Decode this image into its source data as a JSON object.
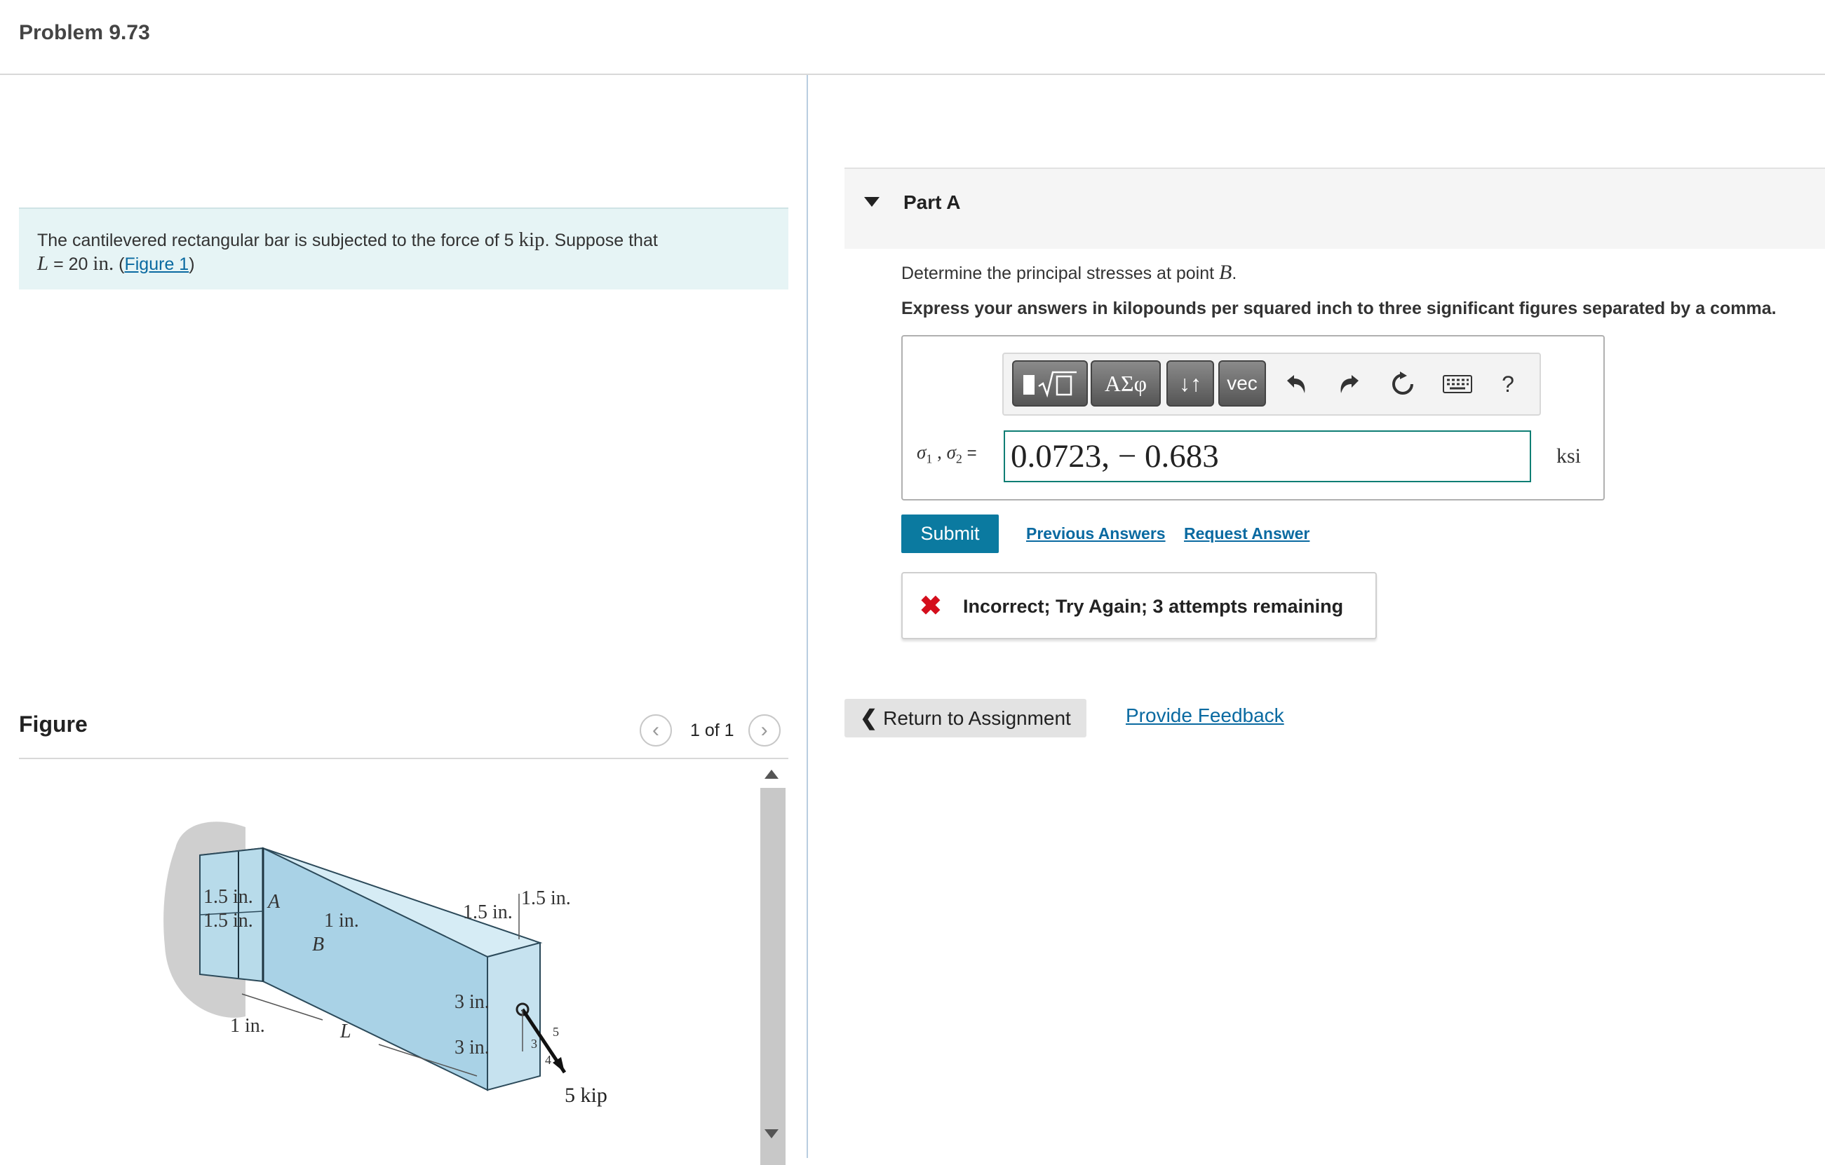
{
  "header": {
    "title": "Problem 9.73"
  },
  "intro": {
    "text_before_force": "The cantilevered rectangular bar is subjected to the force of 5 ",
    "force_unit": "kip",
    "text_after_force": ". Suppose that",
    "length_symbol": "L",
    "length_eq": " = 20 ",
    "length_unit": "in.",
    "paren_open": " (",
    "figure_link": "Figure 1",
    "paren_close": ")"
  },
  "figure_panel": {
    "label": "Figure",
    "prev_icon": "chevron-left-icon",
    "next_icon": "chevron-right-icon",
    "count": "1 of 1",
    "diagram_labels": {
      "a1": "1.5 in.",
      "a2": "1.5 in.",
      "point_a": "A",
      "one_in_top": "1 in.",
      "point_b": "B",
      "one_in_bottom": "1 in.",
      "length": "L",
      "width_mid": "1.5 in.",
      "width_end": "1.5 in.",
      "h1": "3 in.",
      "h2": "3 in.",
      "slope_3": "3",
      "slope_4": "4",
      "slope_5": "5",
      "force": "5 kip"
    }
  },
  "part_a": {
    "title": "Part A",
    "question_prefix": "Determine the principal stresses at point ",
    "question_point": "B",
    "question_suffix": ".",
    "instruction": "Express your answers in kilopounds per squared inch to three significant figures separated by a comma.",
    "toolbar": {
      "templates_icon": "templates-icon",
      "greek_label": "ΑΣφ",
      "arrows_label": "↓↑",
      "vec_label": "vec",
      "undo_icon": "undo-icon",
      "redo_icon": "redo-icon",
      "reset_icon": "reset-icon",
      "keyboard_icon": "keyboard-icon",
      "help_label": "?"
    },
    "answer_label_sigma1": "σ",
    "answer_label_sub1": "1",
    "answer_label_sep": " , ",
    "answer_label_sigma2": "σ",
    "answer_label_sub2": "2",
    "answer_label_eq": " =",
    "answer_value": "0.0723, − 0.683",
    "unit": "ksi",
    "submit_label": "Submit",
    "previous_answers": "Previous Answers",
    "request_answer": "Request Answer",
    "feedback_icon": "x-mark-icon",
    "feedback_text": "Incorrect; Try Again; 3 attempts remaining",
    "status_color": "#d40e1c"
  },
  "footer": {
    "return_label": "Return to Assignment",
    "provide_feedback": "Provide Feedback"
  }
}
